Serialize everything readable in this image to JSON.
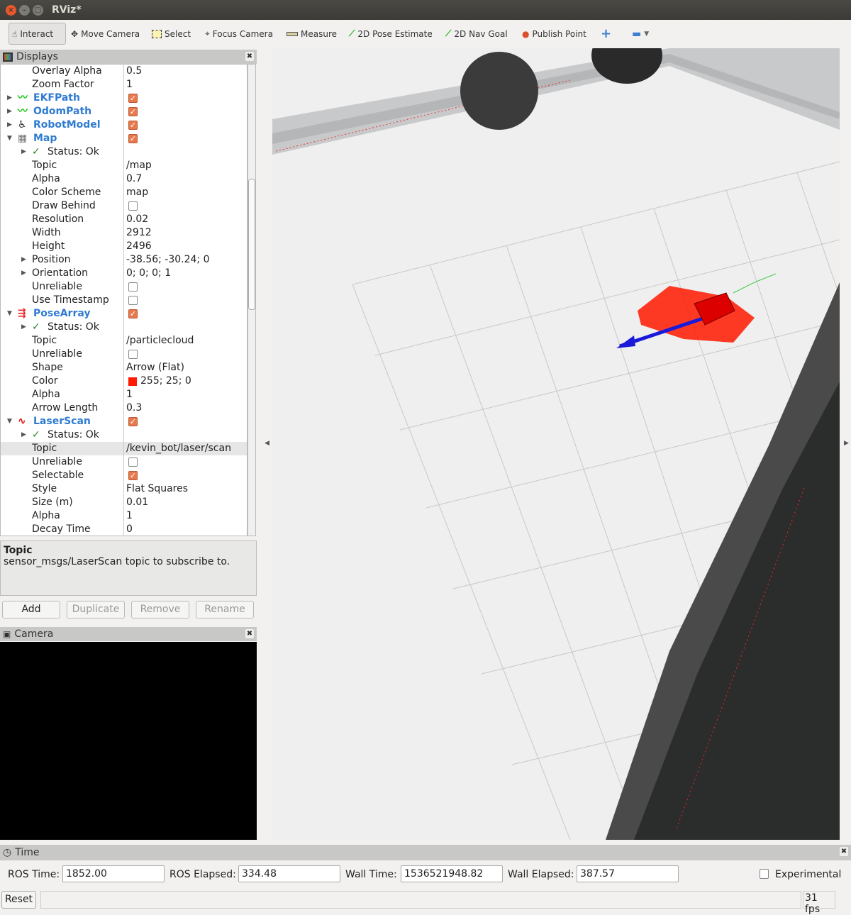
{
  "window": {
    "title": "RViz*"
  },
  "toolbar": {
    "tools": [
      {
        "label": "Interact",
        "icon": "hand-icon"
      },
      {
        "label": "Move Camera",
        "icon": "move-camera-icon"
      },
      {
        "label": "Select",
        "icon": "select-icon"
      },
      {
        "label": "Focus Camera",
        "icon": "focus-icon"
      },
      {
        "label": "Measure",
        "icon": "ruler-icon"
      },
      {
        "label": "2D Pose Estimate",
        "icon": "green-arrow-icon"
      },
      {
        "label": "2D Nav Goal",
        "icon": "green-arrow-icon"
      },
      {
        "label": "Publish Point",
        "icon": "map-pin-icon"
      }
    ]
  },
  "displays": {
    "title": "Displays",
    "rows": [
      {
        "label": "Overlay Alpha",
        "value": "0.5"
      },
      {
        "label": "Zoom Factor",
        "value": "1"
      },
      {
        "label": "EKFPath",
        "type": "display",
        "icon": "path-icon",
        "check": true,
        "exp": "closed"
      },
      {
        "label": "OdomPath",
        "type": "display",
        "icon": "path-icon",
        "check": true,
        "exp": "closed"
      },
      {
        "label": "RobotModel",
        "type": "display",
        "icon": "robot-icon",
        "check": true,
        "exp": "closed"
      },
      {
        "label": "Map",
        "type": "display",
        "icon": "map-icon",
        "check": true,
        "exp": "open"
      },
      {
        "label": "Status: Ok",
        "type": "status"
      },
      {
        "label": "Topic",
        "value": "/map"
      },
      {
        "label": "Alpha",
        "value": "0.7"
      },
      {
        "label": "Color Scheme",
        "value": "map"
      },
      {
        "label": "Draw Behind",
        "check": false
      },
      {
        "label": "Resolution",
        "value": "0.02"
      },
      {
        "label": "Width",
        "value": "2912"
      },
      {
        "label": "Height",
        "value": "2496"
      },
      {
        "label": "Position",
        "value": "-38.56; -30.24; 0",
        "exp": "closed"
      },
      {
        "label": "Orientation",
        "value": "0; 0; 0; 1",
        "exp": "closed"
      },
      {
        "label": "Unreliable",
        "check": false
      },
      {
        "label": "Use Timestamp",
        "check": false
      },
      {
        "label": "PoseArray",
        "type": "display",
        "icon": "pose-array-icon",
        "check": true,
        "exp": "open"
      },
      {
        "label": "Status: Ok",
        "type": "status"
      },
      {
        "label": "Topic",
        "value": "/particlecloud"
      },
      {
        "label": "Unreliable",
        "check": false
      },
      {
        "label": "Shape",
        "value": "Arrow (Flat)"
      },
      {
        "label": "Color",
        "value": "255; 25; 0",
        "swatch": "#ff1900"
      },
      {
        "label": "Alpha",
        "value": "1"
      },
      {
        "label": "Arrow Length",
        "value": "0.3"
      },
      {
        "label": "LaserScan",
        "type": "display",
        "icon": "laser-scan-icon",
        "check": true,
        "exp": "open"
      },
      {
        "label": "Status: Ok",
        "type": "status"
      },
      {
        "label": "Topic",
        "value": "/kevin_bot/laser/scan",
        "selected": true
      },
      {
        "label": "Unreliable",
        "check": false
      },
      {
        "label": "Selectable",
        "check": true
      },
      {
        "label": "Style",
        "value": "Flat Squares"
      },
      {
        "label": "Size (m)",
        "value": "0.01"
      },
      {
        "label": "Alpha",
        "value": "1"
      },
      {
        "label": "Decay Time",
        "value": "0"
      }
    ],
    "description": {
      "title": "Topic",
      "text": "sensor_msgs/LaserScan topic to subscribe to."
    },
    "buttons": {
      "add": "Add",
      "duplicate": "Duplicate",
      "remove": "Remove",
      "rename": "Rename"
    }
  },
  "camera": {
    "title": "Camera"
  },
  "time": {
    "title": "Time",
    "ros_time_label": "ROS Time:",
    "ros_time": "1852.00",
    "ros_elapsed_label": "ROS Elapsed:",
    "ros_elapsed": "334.48",
    "wall_time_label": "Wall Time:",
    "wall_time": "1536521948.82",
    "wall_elapsed_label": "Wall Elapsed:",
    "wall_elapsed": "387.57",
    "experimental": "Experimental"
  },
  "status": {
    "reset": "Reset",
    "fps": "31 fps"
  },
  "colors": {
    "display_name": "#2f7bd2",
    "checkbox": "#e8794d",
    "particles": "#ff1900",
    "pose_arrow": "#1a1ad8"
  }
}
